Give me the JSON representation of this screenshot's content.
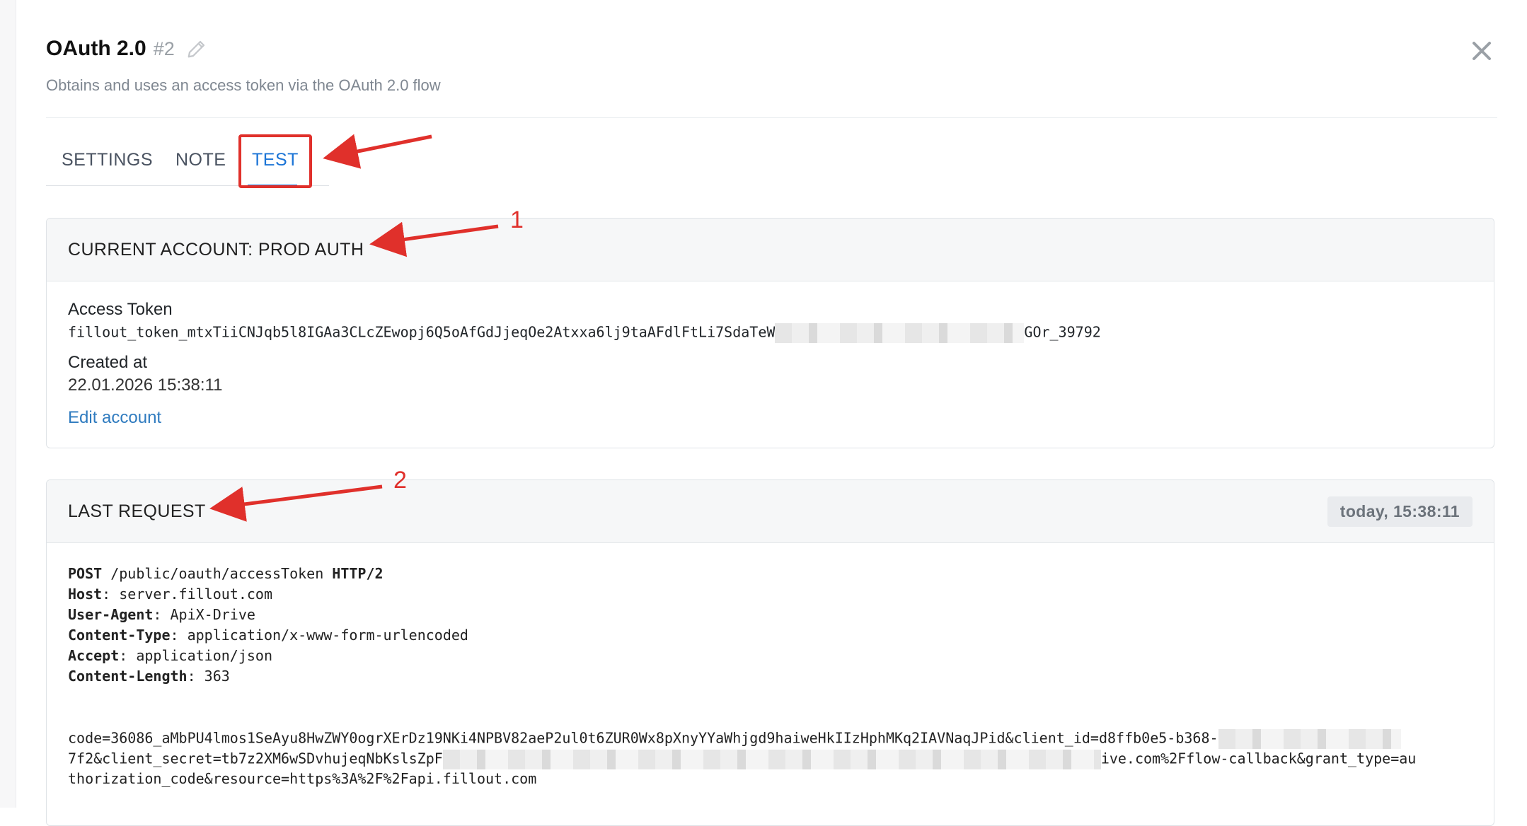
{
  "header": {
    "title": "OAuth 2.0",
    "number": "#2",
    "subtitle": "Obtains and uses an access token via the OAuth 2.0 flow"
  },
  "tabs": [
    {
      "label": "SETTINGS",
      "active": false
    },
    {
      "label": "NOTE",
      "active": false
    },
    {
      "label": "TEST",
      "active": true
    }
  ],
  "account": {
    "header": "CURRENT ACCOUNT: PROD AUTH",
    "access_token_label": "Access Token",
    "access_token_prefix": "fillout_token_mtxTiiCNJqb5l8IGAa3CLcZEwopj6Q5oAfGdJjeqOe2Atxxa6lj9taAFdlFtLi7SdaTeW",
    "access_token_suffix": "GOr_39792",
    "created_label": "Created at",
    "created_value": "22.01.2026 15:38:11",
    "edit_link": "Edit account"
  },
  "last_request": {
    "header": "LAST REQUEST",
    "timestamp": "today, 15:38:11",
    "method": "POST",
    "path": "/public/oauth/accessToken",
    "protocol": "HTTP/2",
    "headers": [
      {
        "name": "Host",
        "value": "server.fillout.com"
      },
      {
        "name": "User-Agent",
        "value": "ApiX-Drive"
      },
      {
        "name": "Content-Type",
        "value": "application/x-www-form-urlencoded"
      },
      {
        "name": "Accept",
        "value": "application/json"
      },
      {
        "name": "Content-Length",
        "value": "363"
      }
    ],
    "body_line1": "code=36086_aMbPU4lmos1SeAyu8HwZWY0ogrXErDz19NKi4NPBV82aeP2ul0t6ZUR0Wx8pXnyYYaWhjgd9haiweHkIIzHphMKq2IAVNaqJPid&client_id=d8ffb0e5-b368-",
    "body_line2_prefix": "7f2&client_secret=tb7z2XM6wSDvhujeqNbKslsZpF",
    "body_line2_suffix": "ive.com%2Fflow-callback&grant_type=au",
    "body_line3": "thorization_code&resource=https%3A%2F%2Fapi.fillout.com"
  },
  "annotations": {
    "marker_1": "1",
    "marker_2": "2",
    "color": "#e0302b"
  },
  "colors": {
    "accent": "#1b74d6",
    "link": "#2f7bbf",
    "highlight": "#e0302b"
  }
}
